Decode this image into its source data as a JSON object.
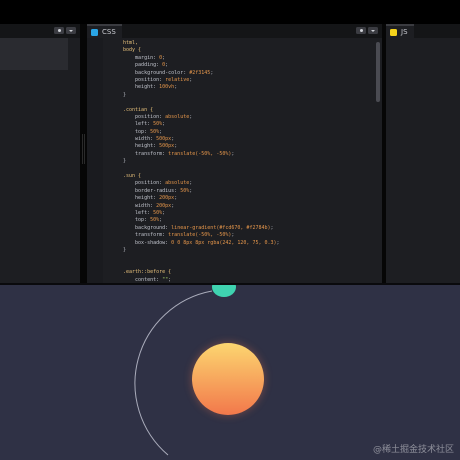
{
  "editor": {
    "css_tab": {
      "label": "CSS",
      "icon": "css-logo"
    },
    "js_tab": {
      "label": "JS",
      "icon": "js-logo"
    },
    "controls": {
      "settings_icon": "gear-icon",
      "menu_icon": "chevron-down-icon"
    },
    "css_lines": [
      [
        [
          "sel",
          "html,"
        ]
      ],
      [
        [
          "sel",
          "body {"
        ]
      ],
      [
        [
          "prop",
          "    margin: "
        ],
        [
          "val",
          "0"
        ],
        [
          "punc",
          ";"
        ]
      ],
      [
        [
          "prop",
          "    padding: "
        ],
        [
          "val",
          "0"
        ],
        [
          "punc",
          ";"
        ]
      ],
      [
        [
          "prop",
          "    background-color: "
        ],
        [
          "val",
          "#2f3145"
        ],
        [
          "punc",
          ";"
        ]
      ],
      [
        [
          "prop",
          "    position: "
        ],
        [
          "val",
          "relative"
        ],
        [
          "punc",
          ";"
        ]
      ],
      [
        [
          "prop",
          "    height: "
        ],
        [
          "val",
          "100vh"
        ],
        [
          "punc",
          ";"
        ]
      ],
      [
        [
          "punc",
          "}"
        ]
      ],
      [
        [
          "prop",
          ""
        ]
      ],
      [
        [
          "sel",
          ".contian {"
        ]
      ],
      [
        [
          "prop",
          "    position: "
        ],
        [
          "val",
          "absolute"
        ],
        [
          "punc",
          ";"
        ]
      ],
      [
        [
          "prop",
          "    left: "
        ],
        [
          "val",
          "50%"
        ],
        [
          "punc",
          ";"
        ]
      ],
      [
        [
          "prop",
          "    top: "
        ],
        [
          "val",
          "50%"
        ],
        [
          "punc",
          ";"
        ]
      ],
      [
        [
          "prop",
          "    width: "
        ],
        [
          "val",
          "500px"
        ],
        [
          "punc",
          ";"
        ]
      ],
      [
        [
          "prop",
          "    height: "
        ],
        [
          "val",
          "500px"
        ],
        [
          "punc",
          ";"
        ]
      ],
      [
        [
          "prop",
          "    transform: "
        ],
        [
          "val",
          "translate(-50%, -50%)"
        ],
        [
          "punc",
          ";"
        ]
      ],
      [
        [
          "punc",
          "}"
        ]
      ],
      [
        [
          "prop",
          ""
        ]
      ],
      [
        [
          "sel",
          ".sun {"
        ]
      ],
      [
        [
          "prop",
          "    position: "
        ],
        [
          "val",
          "absolute"
        ],
        [
          "punc",
          ";"
        ]
      ],
      [
        [
          "prop",
          "    border-radius: "
        ],
        [
          "val",
          "50%"
        ],
        [
          "punc",
          ";"
        ]
      ],
      [
        [
          "prop",
          "    height: "
        ],
        [
          "val",
          "200px"
        ],
        [
          "punc",
          ";"
        ]
      ],
      [
        [
          "prop",
          "    width: "
        ],
        [
          "val",
          "200px"
        ],
        [
          "punc",
          ";"
        ]
      ],
      [
        [
          "prop",
          "    left: "
        ],
        [
          "val",
          "50%"
        ],
        [
          "punc",
          ";"
        ]
      ],
      [
        [
          "prop",
          "    top: "
        ],
        [
          "val",
          "50%"
        ],
        [
          "punc",
          ";"
        ]
      ],
      [
        [
          "prop",
          "    background: "
        ],
        [
          "val",
          "linear-gradient(#fcd670, #f2784b)"
        ],
        [
          "punc",
          ";"
        ]
      ],
      [
        [
          "prop",
          "    transform: "
        ],
        [
          "val",
          "translate(-50%, -50%)"
        ],
        [
          "punc",
          ";"
        ]
      ],
      [
        [
          "prop",
          "    box-shadow: "
        ],
        [
          "val",
          "0 0 8px 8px rgba(242, 120, 75, 0.3)"
        ],
        [
          "punc",
          ";"
        ]
      ],
      [
        [
          "punc",
          "}"
        ]
      ],
      [
        [
          "prop",
          ""
        ]
      ],
      [
        [
          "prop",
          ""
        ]
      ],
      [
        [
          "sel",
          ".earth::before {"
        ]
      ],
      [
        [
          "prop",
          "    content: "
        ],
        [
          "str",
          "\"\""
        ],
        [
          "punc",
          ";"
        ]
      ]
    ]
  },
  "preview": {
    "watermark": "@稀土掘金技术社区",
    "colors": {
      "background": "#2f3145",
      "sun_top": "#fcd670",
      "sun_bottom": "#f2784b",
      "earth": "#3fd3b0",
      "orbit": "#bfc2d0"
    }
  }
}
